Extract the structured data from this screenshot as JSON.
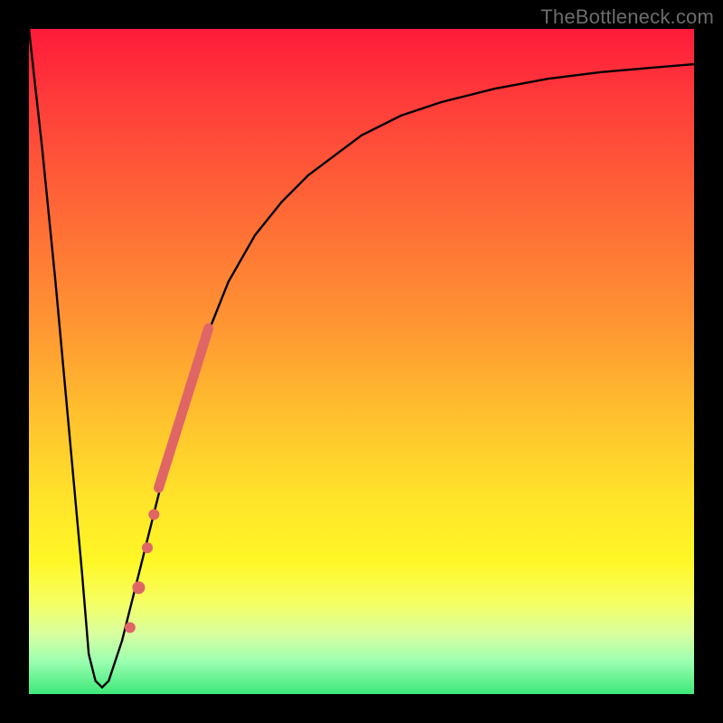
{
  "watermark": "TheBottleneck.com",
  "chart_data": {
    "type": "line",
    "title": "",
    "xlabel": "",
    "ylabel": "",
    "xlim": [
      0,
      100
    ],
    "ylim": [
      0,
      100
    ],
    "grid": false,
    "legend": false,
    "series": [
      {
        "name": "bottleneck-curve",
        "color": "#000000",
        "x": [
          0,
          2,
          4,
          6,
          8,
          9,
          10,
          11,
          12,
          14,
          16,
          18,
          20,
          22,
          24,
          26,
          28,
          30,
          34,
          38,
          42,
          46,
          50,
          56,
          62,
          70,
          78,
          86,
          94,
          100
        ],
        "y": [
          100,
          82,
          62,
          40,
          18,
          6,
          2,
          1,
          2,
          8,
          16,
          24,
          32,
          40,
          46,
          52,
          57,
          62,
          69,
          74,
          78,
          81,
          84,
          87,
          89,
          91,
          92.5,
          93.5,
          94.2,
          94.7
        ]
      }
    ],
    "markers": [
      {
        "name": "highlight-band",
        "type": "thick-line",
        "color": "#e06666",
        "x": [
          19.5,
          27.0
        ],
        "y": [
          31,
          55
        ],
        "width": 11
      },
      {
        "name": "dot-1",
        "type": "circle",
        "color": "#e06666",
        "cx": 18.8,
        "cy": 27,
        "r": 6
      },
      {
        "name": "dot-2",
        "type": "circle",
        "color": "#e06666",
        "cx": 17.8,
        "cy": 22,
        "r": 6
      },
      {
        "name": "dot-3",
        "type": "circle",
        "color": "#e06666",
        "cx": 16.5,
        "cy": 16,
        "r": 7
      },
      {
        "name": "dot-4",
        "type": "circle",
        "color": "#e06666",
        "cx": 15.2,
        "cy": 10,
        "r": 6
      }
    ]
  }
}
